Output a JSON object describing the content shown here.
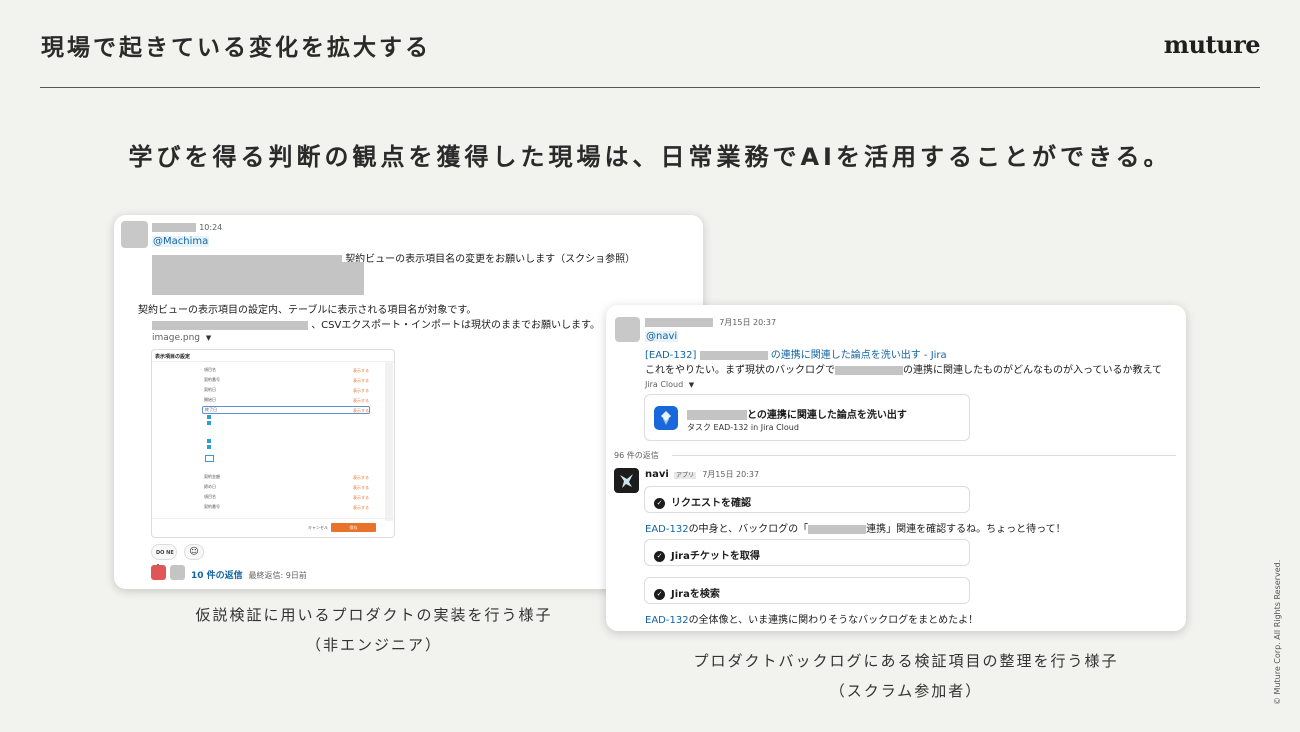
{
  "header": {
    "title": "現場で起きている変化を拡大する",
    "logo": "muture"
  },
  "headline": "学びを得る判断の観点を獲得した現場は、日常業務でAIを活用することができる。",
  "card1": {
    "time": "10:24",
    "mention": "@Machima",
    "line1": "契約ビューの表示項目名の変更をお願いします（スクショ参照）",
    "line2": "契約ビューの表示項目の設定内、テーブルに表示される項目名が対象です。",
    "line3": "、CSVエクスポート・インポートは現状のままでお願いします。",
    "attachment": "image.png",
    "attachment_caret": "▼",
    "image_title": "表示項目の設定",
    "image_rows": [
      "項目名",
      "契約番号",
      "契約日",
      "開始日",
      "終了日",
      "契約金額",
      "締め日"
    ],
    "image_tag": "表示する",
    "image_cancel": "キャンセル",
    "image_save": "保存",
    "reaction_emoji": "DO NE",
    "reaction_count": "1",
    "add_reaction_icon": "add-emoji-icon",
    "replies_label": "10 件の返信",
    "last_reply": "最終返信: 9日前"
  },
  "card2": {
    "time": "7月15日 20:37",
    "mention": "@navi",
    "ticket_link_prefix": "[EAD-132]",
    "ticket_link_suffix": "の連携に関連した論点を洗い出す - Jira",
    "request_prefix": "これをやりたい。まず現状のバックログで",
    "request_suffix": "の連携に関連したものがどんなものが入っているか教えて",
    "unfurl_source": "Jira Cloud",
    "unfurl_caret": "▼",
    "unfurl_title_suffix": "との連携に関連した論点を洗い出す",
    "unfurl_sub": "タスク EAD-132 in Jira Cloud",
    "replies_count": "96 件の返信",
    "bot_name": "navi",
    "bot_badge": "アプリ",
    "bot_time": "7月15日 20:37",
    "step1": "リクエストを確認",
    "msg1_link": "EAD-132",
    "msg1_mid": "の中身と、バックログの「",
    "msg1_end": "連携」関連を確認するね。ちょっと待って！",
    "step2": "Jiraチケットを取得",
    "step3": "Jiraを検索",
    "msg2_link": "EAD-132",
    "msg2_end": "の全体像と、いま連携に関わりそうなバックログをまとめたよ！"
  },
  "captions": {
    "left_line1": "仮説検証に用いるプロダクトの実装を行う様子",
    "left_line2": "（非エンジニア）",
    "right_line1": "プロダクトバックログにある検証項目の整理を行う様子",
    "right_line2": "（スクラム参加者）"
  },
  "copyright": "© Muture Corp. All Rights Reserved.",
  "colors": {
    "background": "#f2f2ef",
    "link": "#1264a3",
    "jira_blue": "#1868db",
    "accent_orange": "#e8722a"
  }
}
